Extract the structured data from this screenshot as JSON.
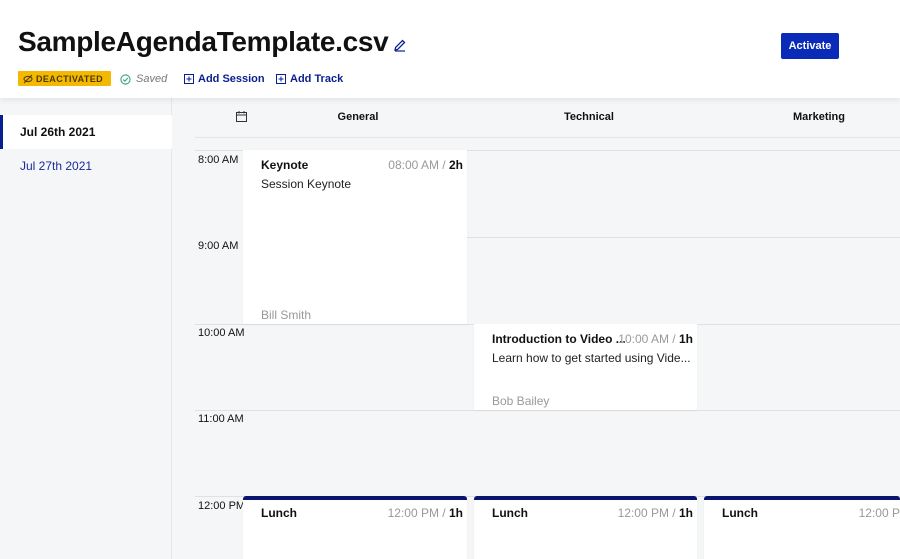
{
  "header": {
    "title": "SampleAgendaTemplate.csv",
    "status_badge": "DEACTIVATED",
    "saved_label": "Saved",
    "add_session_label": "Add Session",
    "add_track_label": "Add Track",
    "activate_label": "Activate"
  },
  "sidebar": {
    "days": [
      {
        "label": "Jul 26th 2021",
        "active": true
      },
      {
        "label": "Jul 27th 2021",
        "active": false
      }
    ]
  },
  "grid": {
    "tracks": [
      "General",
      "Technical",
      "Marketing"
    ],
    "times": [
      "8:00 AM",
      "9:00 AM",
      "10:00 AM",
      "11:00 AM",
      "12:00 PM"
    ],
    "sessions": [
      {
        "title": "Keynote",
        "start": "08:00 AM",
        "duration": "2h",
        "description": "Session Keynote",
        "speaker": "Bill Smith",
        "track": "General"
      },
      {
        "title": "Introduction to Video ...",
        "start": "10:00 AM",
        "duration": "1h",
        "description": "Learn how to get started using Vide...",
        "speaker": "Bob Bailey",
        "track": "Technical"
      },
      {
        "title": "Lunch",
        "start": "12:00 PM",
        "duration": "1h",
        "track": "General"
      },
      {
        "title": "Lunch",
        "start": "12:00 PM",
        "duration": "1h",
        "track": "Technical"
      },
      {
        "title": "Lunch",
        "start": "12:00 P",
        "duration": "",
        "track": "Marketing"
      }
    ]
  },
  "colors": {
    "accent": "#0a2ab8",
    "badge": "#f5b800",
    "link": "#0a1f8f",
    "session_top": "#0a1570"
  }
}
